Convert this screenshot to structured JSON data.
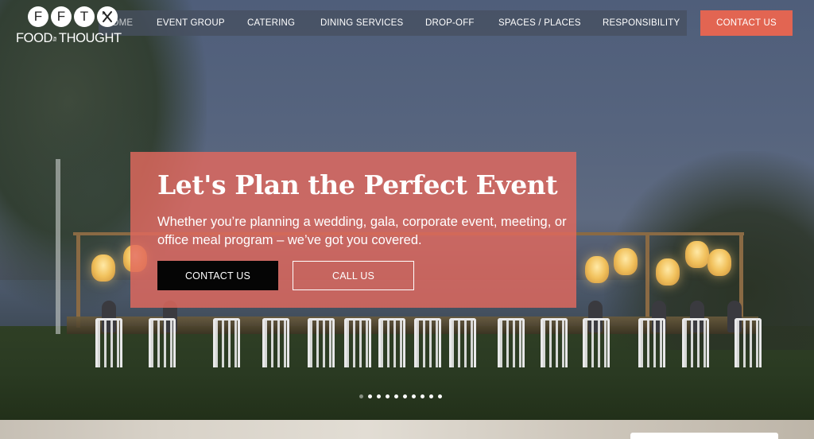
{
  "logo": {
    "letters": [
      "F",
      "F",
      "T"
    ],
    "icon": "fork-knife-icon",
    "text_left": "FOOD",
    "text_small": "for",
    "text_right": "THOUGHT"
  },
  "nav": {
    "items": [
      "HOME",
      "EVENT GROUP",
      "CATERING",
      "DINING SERVICES",
      "DROP-OFF",
      "SPACES / PLACES",
      "RESPONSIBILITY"
    ],
    "contact_label": "CONTACT US"
  },
  "hero": {
    "headline": "Let's Plan the Perfect Event",
    "subtext": "Whether you’re planning a wedding, gala, corporate event, meeting, or office meal program – we’ve got you covered.",
    "contact_button": "CONTACT US",
    "call_button": "CALL US",
    "slide_count": 10,
    "active_slide": 2
  },
  "colors": {
    "accent": "#e26552",
    "panel": "#e2695e",
    "nav_bg": "#465060",
    "button_dark": "#050505"
  }
}
